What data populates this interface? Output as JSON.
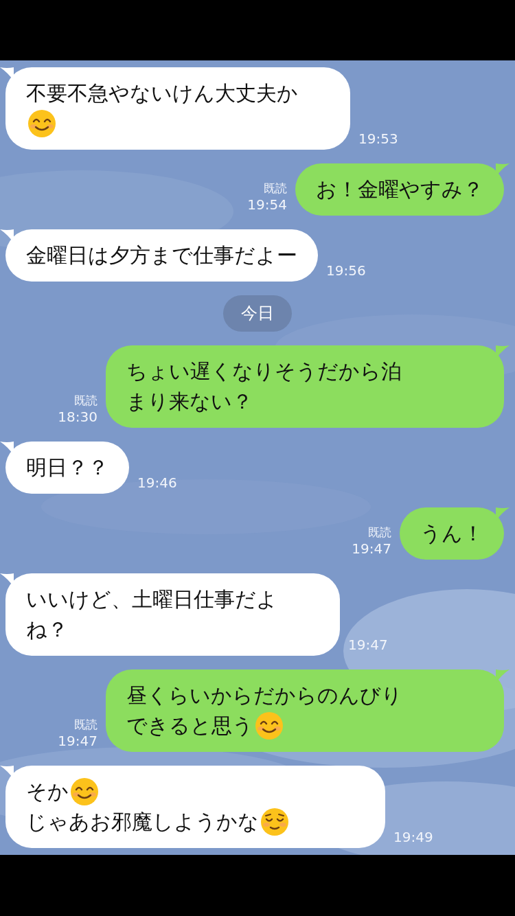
{
  "messages": [
    {
      "kind": "incoming",
      "parts": [
        {
          "kind": "text",
          "text": "不要不急やないけん大丈夫か"
        },
        {
          "kind": "break"
        },
        {
          "kind": "smile"
        }
      ],
      "time": "19:53"
    },
    {
      "kind": "outgoing",
      "read_label": "既読",
      "time": "19:54",
      "parts": [
        {
          "kind": "text",
          "text": "お！金曜やすみ？"
        }
      ]
    },
    {
      "kind": "incoming",
      "parts": [
        {
          "kind": "text",
          "text": "金曜日は夕方まで仕事だよー"
        }
      ],
      "time": "19:56"
    },
    {
      "kind": "date",
      "text": "今日"
    },
    {
      "kind": "outgoing",
      "read_label": "既読",
      "time": "18:30",
      "parts": [
        {
          "kind": "text",
          "text": "ちょい遅くなりそうだから泊"
        },
        {
          "kind": "break"
        },
        {
          "kind": "text",
          "text": "まり来ない？"
        }
      ]
    },
    {
      "kind": "incoming",
      "parts": [
        {
          "kind": "text",
          "text": "明日？？"
        }
      ],
      "time": "19:46"
    },
    {
      "kind": "outgoing",
      "read_label": "既読",
      "time": "19:47",
      "parts": [
        {
          "kind": "text",
          "text": "うん！"
        }
      ]
    },
    {
      "kind": "incoming",
      "parts": [
        {
          "kind": "text",
          "text": "いいけど、土曜日仕事だよ"
        },
        {
          "kind": "break"
        },
        {
          "kind": "text",
          "text": "ね？"
        }
      ],
      "time": "19:47"
    },
    {
      "kind": "outgoing",
      "read_label": "既読",
      "time": "19:47",
      "parts": [
        {
          "kind": "text",
          "text": "昼くらいからだからのんびり"
        },
        {
          "kind": "break"
        },
        {
          "kind": "text",
          "text": "できると思う"
        },
        {
          "kind": "smile"
        }
      ]
    },
    {
      "kind": "incoming",
      "parts": [
        {
          "kind": "text",
          "text": "そか"
        },
        {
          "kind": "smile"
        },
        {
          "kind": "break"
        },
        {
          "kind": "text",
          "text": "じゃあお邪魔しようかな"
        },
        {
          "kind": "relieved"
        }
      ],
      "time": "19:49"
    }
  ]
}
